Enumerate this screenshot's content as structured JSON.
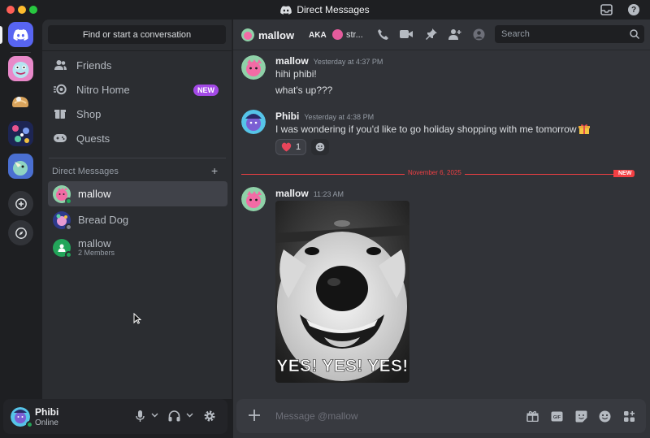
{
  "window": {
    "title": "Direct Messages"
  },
  "sidebar": {
    "find_label": "Find or start a conversation",
    "nav": [
      {
        "label": "Friends",
        "icon": "friends-icon"
      },
      {
        "label": "Nitro Home",
        "icon": "nitro-icon",
        "badge": "NEW"
      },
      {
        "label": "Shop",
        "icon": "shop-icon"
      },
      {
        "label": "Quests",
        "icon": "quests-icon"
      }
    ],
    "dm_header": "Direct Messages",
    "dm_add": "+",
    "dms": [
      {
        "name": "mallow",
        "status": "online",
        "selected": true
      },
      {
        "name": "Bread Dog",
        "status": "offline"
      },
      {
        "name": "mallow",
        "subtitle": "2 Members",
        "group": true
      }
    ]
  },
  "user": {
    "name": "Phibi",
    "status": "Online"
  },
  "chat_header": {
    "name": "mallow",
    "aka_label": "AKA",
    "aka_name": "str...",
    "search_placeholder": "Search"
  },
  "messages": [
    {
      "author": "mallow",
      "time": "Yesterday at 4:37 PM",
      "lines": [
        "hihi phibi!",
        "what's up???"
      ]
    },
    {
      "author": "Phibi",
      "time": "Yesterday at 4:38 PM",
      "lines": [
        "I was wondering if you'd like to go holiday shopping with me tomorrow"
      ],
      "reaction": {
        "emoji": "heart",
        "count": "1"
      }
    },
    {
      "author": "mallow",
      "time": "11:23 AM",
      "gif_caption": "YES! YES! YES!"
    }
  ],
  "divider": {
    "date": "November 6, 2025",
    "badge": "NEW"
  },
  "composer": {
    "placeholder": "Message @mallow"
  },
  "colors": {
    "accent": "#5865f2",
    "online": "#23a55a",
    "new_line": "#f23f43",
    "nitro_badge": "#a349e6"
  }
}
